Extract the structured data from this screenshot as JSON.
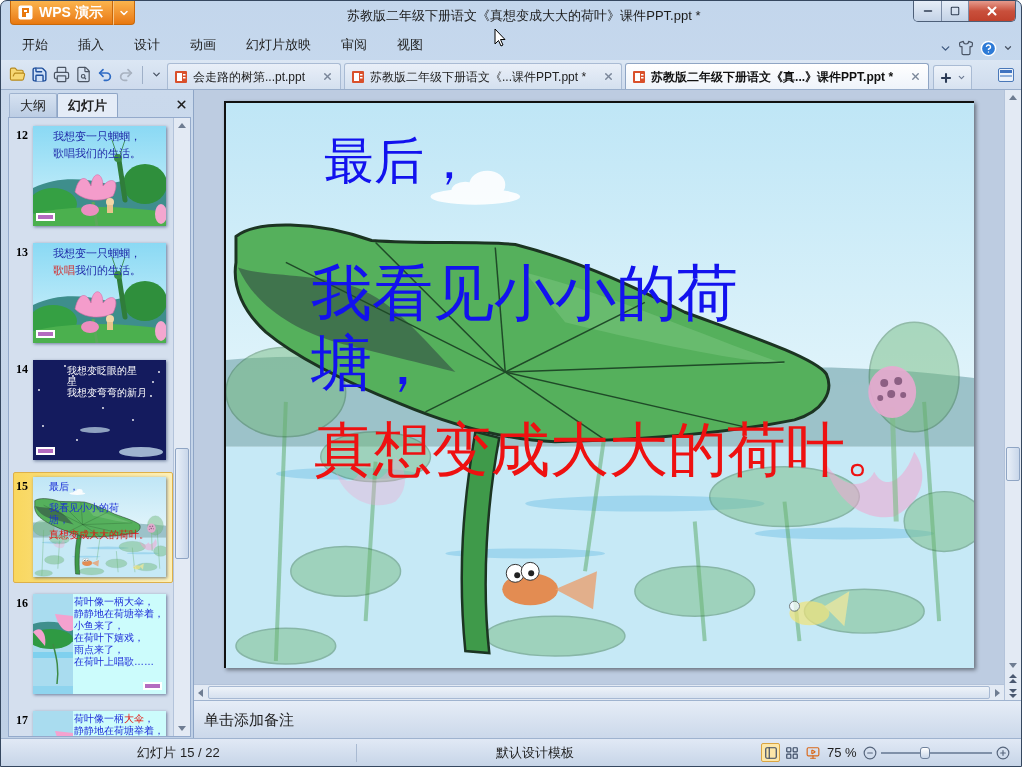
{
  "app_button": {
    "label": "WPS 演示"
  },
  "window": {
    "title": "苏教版二年级下册语文《真想变成大大的荷叶》课件PPT.ppt *"
  },
  "menu": [
    "开始",
    "插入",
    "设计",
    "动画",
    "幻灯片放映",
    "审阅",
    "视图"
  ],
  "quick_access": {
    "undo": {
      "disabled": false
    },
    "redo": {
      "disabled": true
    }
  },
  "doc_tabs": [
    {
      "label": "会走路的树第...pt.ppt",
      "selected": false
    },
    {
      "label": "苏教版二年级下册语文《...课件PPT.ppt *",
      "selected": false
    },
    {
      "label": "苏教版二年级下册语文《真...》课件PPT.ppt *",
      "selected": true
    }
  ],
  "panel": {
    "tabs": [
      {
        "label": "大纲",
        "selected": false
      },
      {
        "label": "幻灯片",
        "selected": true
      }
    ]
  },
  "slides": [
    {
      "number": "12",
      "kind": "pond",
      "selected": false,
      "lines": [
        [
          {
            "text": "我想变一只蝈蝈，",
            "highlight": false
          }
        ],
        [
          {
            "text": "歌唱我们的生活。",
            "highlight": false
          }
        ]
      ]
    },
    {
      "number": "13",
      "kind": "pond",
      "selected": false,
      "lines": [
        [
          {
            "text": "我想变一只蝈蝈，",
            "highlight": false
          }
        ],
        [
          {
            "text": "歌唱",
            "highlight": true
          },
          {
            "text": "我们的生活。",
            "highlight": false
          }
        ]
      ]
    },
    {
      "number": "14",
      "kind": "night",
      "selected": false,
      "lines": [
        [
          {
            "text": "我想变眨眼的星",
            "highlight": false
          }
        ],
        [
          {
            "text": "星",
            "highlight": false
          }
        ],
        [
          {
            "text": "我想变弯弯的新月",
            "highlight": false
          }
        ]
      ]
    },
    {
      "number": "15",
      "kind": "leaf",
      "selected": true,
      "lines": [
        [
          {
            "text": "最后，",
            "highlight": false
          }
        ],
        [
          {
            "text": "我看见小小的荷",
            "highlight": false
          }
        ],
        [
          {
            "text": "塘，",
            "highlight": false
          }
        ],
        [
          {
            "text": "真想变成大大的荷叶。",
            "highlight": true
          }
        ]
      ]
    },
    {
      "number": "16",
      "kind": "side",
      "selected": false,
      "lines": [
        [
          {
            "text": "荷叶像一柄大伞，",
            "highlight": false
          }
        ],
        [
          {
            "text": "静静地在荷塘举着，",
            "highlight": false
          }
        ],
        [
          {
            "text": "小鱼来了，",
            "highlight": false
          }
        ],
        [
          {
            "text": "在荷叶下嬉戏，",
            "highlight": false
          }
        ],
        [
          {
            "text": "雨点来了，",
            "highlight": false
          }
        ],
        [
          {
            "text": "在荷叶上唱歌……",
            "highlight": false
          }
        ]
      ]
    },
    {
      "number": "17",
      "kind": "side",
      "selected": false,
      "lines": [
        [
          {
            "text": "荷叶像一柄",
            "highlight": false
          },
          {
            "text": "大伞",
            "highlight": true
          },
          {
            "text": "，",
            "highlight": false
          }
        ],
        [
          {
            "text": "静静地在荷塘举着，",
            "highlight": false
          }
        ]
      ]
    }
  ],
  "current_slide": {
    "kind": "leaf",
    "lines": [
      [
        {
          "text": "最后，",
          "highlight": false
        }
      ],
      [
        {
          "text": "我看见小小的荷",
          "highlight": false
        }
      ],
      [
        {
          "text": "塘，",
          "highlight": false
        }
      ],
      [
        {
          "text": "真想变成大大的荷叶。",
          "highlight": true
        }
      ]
    ]
  },
  "notes": {
    "placeholder": "单击添加备注"
  },
  "status_bar": {
    "slide_counter": "幻灯片 15 / 22",
    "template": "默认设计模板",
    "views": [
      {
        "kind": "normal",
        "selected": true
      },
      {
        "kind": "sorter",
        "selected": false
      },
      {
        "kind": "show",
        "selected": false
      }
    ],
    "zoom": "75 %",
    "zoom_slider": {
      "level": 0.4
    }
  }
}
